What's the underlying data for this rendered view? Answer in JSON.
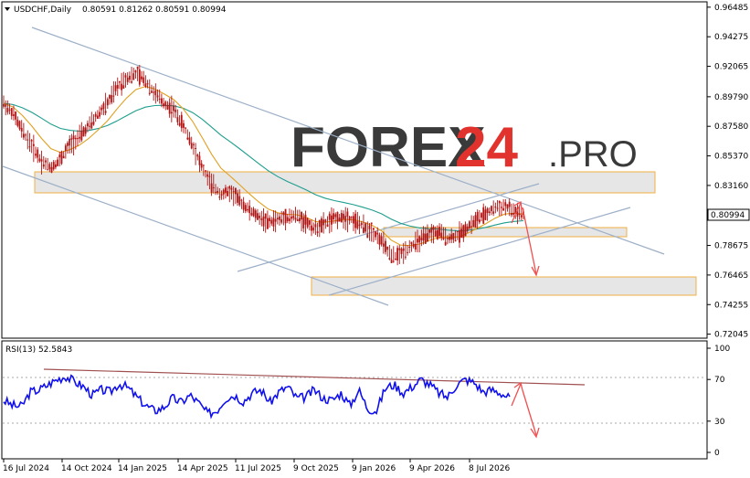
{
  "header": {
    "symbol": "USDCHF,Daily",
    "ohlc": "0.80591 0.81262 0.80591 0.80994"
  },
  "logo": {
    "brand": "FOREX",
    "number": "24",
    "suffix": ".PRO"
  },
  "rsi": {
    "label": "RSI(13) 52.5843"
  },
  "price_label": "0.80994",
  "colors": {
    "candle": "#b01515",
    "ema_fast": "#e0a020",
    "ema_slow": "#1e9e8e",
    "rsi_line": "#1010ee",
    "channel": "#9db0c8",
    "rsi_trend": "#a05050",
    "arrow": "#f05050",
    "zone": "#e6e6e6",
    "zone_border": "#f0b040"
  },
  "chart_data": [
    {
      "type": "line",
      "title": "",
      "xlabel": "",
      "ylabel": "",
      "ylim": [
        0.7195,
        0.9668
      ],
      "grid": false,
      "y_ticks": [
        "0.96485",
        "0.94275",
        "0.92065",
        "0.89790",
        "0.87580",
        "0.85370",
        "0.83160",
        "0.80994",
        "0.78675",
        "0.76465",
        "0.74255",
        "0.72045"
      ],
      "x_ticks": [
        "16 Jul 2024",
        "14 Oct 2024",
        "14 Jan 2025",
        "14 Apr 2025",
        "11 Jul 2025",
        "9 Oct 2025",
        "9 Jan 2026",
        "9 Apr 2026",
        "8 Jul 2026"
      ],
      "series": [
        {
          "values": [
            0.893,
            0.885,
            0.872,
            0.861,
            0.85,
            0.845,
            0.851,
            0.862,
            0.868,
            0.876,
            0.885,
            0.893,
            0.905,
            0.912,
            0.915,
            0.91,
            0.9,
            0.893,
            0.888,
            0.876,
            0.862,
            0.845,
            0.832,
            0.825,
            0.827,
            0.82,
            0.813,
            0.808,
            0.804,
            0.806,
            0.808,
            0.809,
            0.804,
            0.799,
            0.803,
            0.807,
            0.808,
            0.806,
            0.801,
            0.797,
            0.79,
            0.778,
            0.78,
            0.786,
            0.79,
            0.795,
            0.797,
            0.792,
            0.794,
            0.8,
            0.806,
            0.81,
            0.815,
            0.816,
            0.812,
            0.809
          ]
        }
      ]
    },
    {
      "type": "line",
      "title": "",
      "ylim": [
        0,
        100
      ],
      "y_ticks": [
        "100",
        "70",
        "30",
        "0"
      ],
      "series": [
        {
          "values": [
            50,
            45,
            44,
            58,
            60,
            65,
            70,
            73,
            68,
            63,
            55,
            60,
            58,
            66,
            62,
            53,
            45,
            40,
            43,
            52,
            48,
            55,
            47,
            37,
            40,
            52,
            55,
            49,
            57,
            60,
            48,
            58,
            63,
            52,
            53,
            60,
            52,
            50,
            57,
            45,
            60,
            42,
            40,
            62,
            65,
            57,
            63,
            70,
            65,
            57,
            53,
            65,
            70,
            67,
            58,
            60,
            57,
            52
          ]
        }
      ]
    }
  ]
}
